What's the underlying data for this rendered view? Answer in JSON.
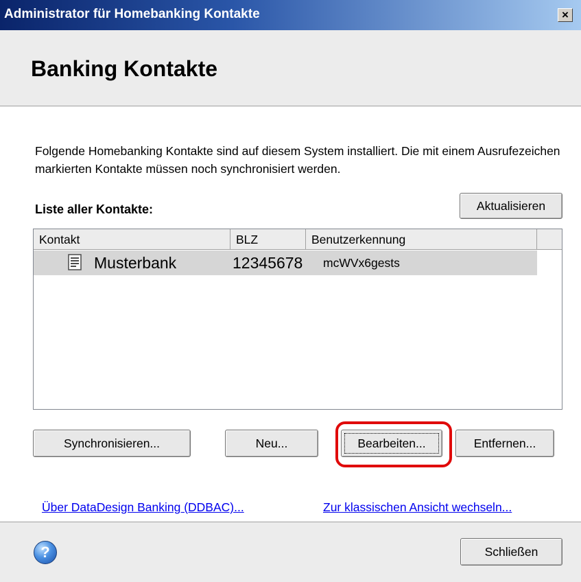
{
  "window": {
    "title": "Administrator für Homebanking Kontakte",
    "close_label": "×"
  },
  "header": {
    "title": "Banking Kontakte"
  },
  "description": "Folgende Homebanking Kontakte sind auf diesem System installiert. Die mit einem Ausrufezeichen markierten Kontakte müssen noch synchronisiert werden.",
  "list": {
    "label": "Liste aller Kontakte:",
    "refresh_label": "Aktualisieren",
    "columns": [
      "Kontakt",
      "BLZ",
      "Benutzerkennung"
    ],
    "rows": [
      {
        "kontakt": "Musterbank",
        "blz": "12345678",
        "benutzerkennung": "mcWVx6gests"
      }
    ]
  },
  "buttons": {
    "sync": "Synchronisieren...",
    "new": "Neu...",
    "edit": "Bearbeiten...",
    "remove": "Entfernen..."
  },
  "links": {
    "about": "Über DataDesign Banking (DDBAC)...",
    "classic": "Zur klassischen Ansicht wechseln..."
  },
  "footer": {
    "help_label": "?",
    "close_label": "Schließen"
  },
  "colors": {
    "highlight": "#e00a0a",
    "link": "#0000ee",
    "titlebar": "#0a246a"
  },
  "icons": [
    "close-icon",
    "document-icon",
    "help-icon"
  ]
}
